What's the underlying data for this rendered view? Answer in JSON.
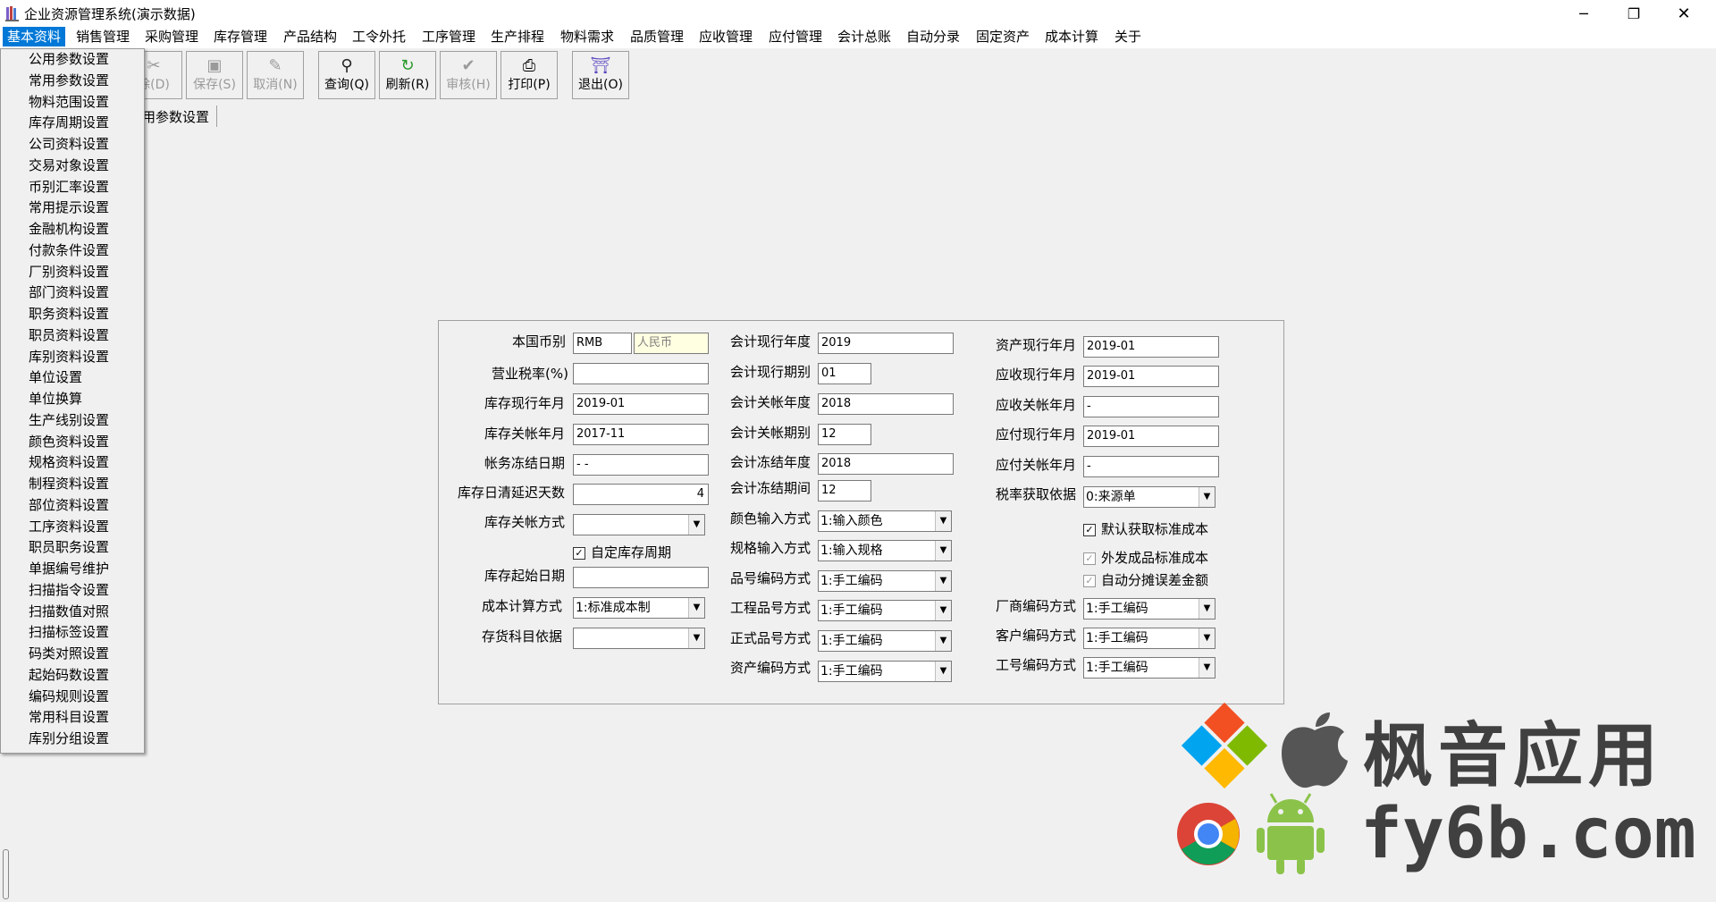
{
  "window": {
    "title": "企业资源管理系统(演示数据)",
    "minimize": "─",
    "restore": "❐",
    "close": "✕"
  },
  "menu": [
    "基本资料",
    "销售管理",
    "采购管理",
    "库存管理",
    "产品结构",
    "工令外托",
    "工序管理",
    "生产排程",
    "物料需求",
    "品质管理",
    "应收管理",
    "应付管理",
    "会计总账",
    "自动分录",
    "固定资产",
    "成本计算",
    "关于"
  ],
  "toolbar": {
    "delete": "除(D)",
    "save": "保存(S)",
    "cancel": "取消(N)",
    "query": "查询(Q)",
    "refresh": "刷新(R)",
    "approve": "审核(H)",
    "print": "打印(P)",
    "exit": "退出(O)"
  },
  "tab": {
    "label": "用参数设置"
  },
  "dropdown": [
    "公用参数设置",
    "常用参数设置",
    "物料范围设置",
    "库存周期设置",
    "公司资料设置",
    "交易对象设置",
    "币别汇率设置",
    "常用提示设置",
    "金融机构设置",
    "付款条件设置",
    "厂别资料设置",
    "部门资料设置",
    "职务资料设置",
    "职员资料设置",
    "库别资料设置",
    "单位设置",
    "单位换算",
    "生产线别设置",
    "颜色资料设置",
    "规格资料设置",
    "制程资料设置",
    "部位资料设置",
    "工序资料设置",
    "职员职务设置",
    "单据编号维护",
    "扫描指令设置",
    "扫描数值对照",
    "扫描标签设置",
    "码类对照设置",
    "起始码数设置",
    "编码规则设置",
    "常用科目设置",
    "库别分组设置"
  ],
  "form": {
    "col1": {
      "currency_label": "本国币别",
      "currency_code": "RMB",
      "currency_name": "人民币",
      "tax_label": "营业税率(%)",
      "tax_value": "",
      "inv_cur_label": "库存现行年月",
      "inv_cur_value": "2019-01",
      "inv_close_label": "库存关帐年月",
      "inv_close_value": "2017-11",
      "freeze_label": "帐务冻结日期",
      "freeze_value": " -  -",
      "delay_label": "库存日清延迟天数",
      "delay_value": "4",
      "close_method_label": "库存关帐方式",
      "close_method_value": "",
      "custom_period_label": "自定库存周期",
      "start_date_label": "库存起始日期",
      "start_date_value": "",
      "cost_method_label": "成本计算方式",
      "cost_method_value": "1:标准成本制",
      "stock_subject_label": "存货科目依据",
      "stock_subject_value": ""
    },
    "col2": {
      "acc_year_label": "会计现行年度",
      "acc_year_value": "2019",
      "acc_period_label": "会计现行期别",
      "acc_period_value": "01",
      "acc_close_year_label": "会计关帐年度",
      "acc_close_year_value": "2018",
      "acc_close_period_label": "会计关帐期别",
      "acc_close_period_value": "12",
      "acc_freeze_year_label": "会计冻结年度",
      "acc_freeze_year_value": "2018",
      "acc_freeze_period_label": "会计冻结期间",
      "acc_freeze_period_value": "12",
      "color_input_label": "颜色输入方式",
      "color_input_value": "1:输入颜色",
      "spec_input_label": "规格输入方式",
      "spec_input_value": "1:输入规格",
      "item_code_label": "品号编码方式",
      "item_code_value": "1:手工编码",
      "eng_code_label": "工程品号方式",
      "eng_code_value": "1:手工编码",
      "formal_code_label": "正式品号方式",
      "formal_code_value": "1:手工编码",
      "asset_code_label": "资产编码方式",
      "asset_code_value": "1:手工编码"
    },
    "col3": {
      "asset_cur_label": "资产现行年月",
      "asset_cur_value": "2019-01",
      "ar_cur_label": "应收现行年月",
      "ar_cur_value": "2019-01",
      "ar_close_label": "应收关帐年月",
      "ar_close_value": "  -",
      "ap_cur_label": "应付现行年月",
      "ap_cur_value": "2019-01",
      "ap_close_label": "应付关帐年月",
      "ap_close_value": "  -",
      "tax_basis_label": "税率获取依据",
      "tax_basis_value": "0:来源单",
      "default_std_cost_label": "默认获取标准成本",
      "outsource_std_cost_label": "外发成品标准成本",
      "auto_diff_label": "自动分摊误差金额",
      "vendor_code_label": "厂商编码方式",
      "vendor_code_value": "1:手工编码",
      "customer_code_label": "客户编码方式",
      "customer_code_value": "1:手工编码",
      "job_code_label": "工号编码方式",
      "job_code_value": "1:手工编码"
    }
  },
  "watermark": {
    "cn": "枫音应用",
    "url": "fy6b.com"
  },
  "colors": {
    "menu_active": "#0078d7",
    "readonly_field": "#ffffe1"
  }
}
